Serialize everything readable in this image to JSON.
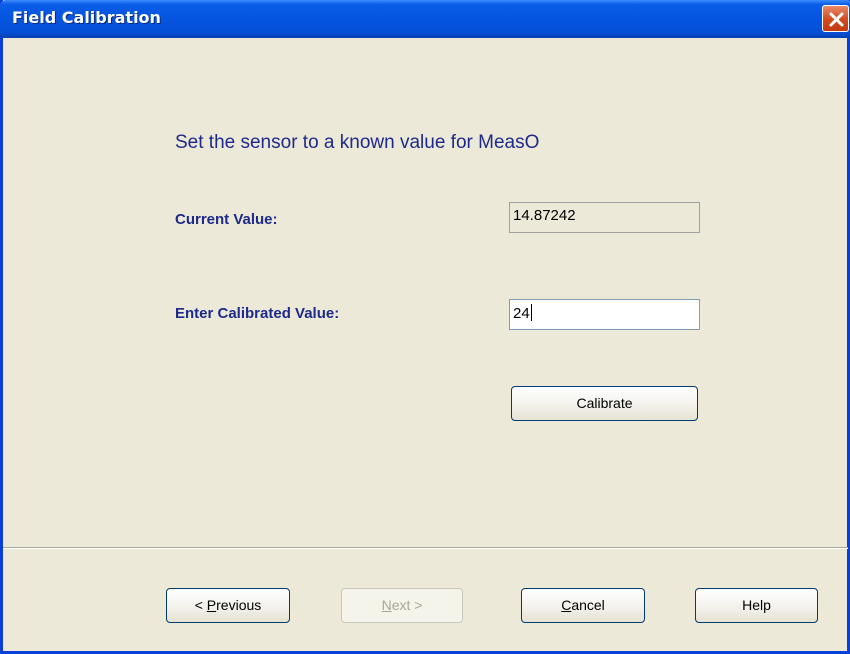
{
  "window": {
    "title": "Field Calibration"
  },
  "main": {
    "heading": "Set the sensor to a known value for MeasO",
    "current_value_label": "Current Value:",
    "current_value": "14.87242",
    "calibrated_value_label": "Enter Calibrated Value:",
    "calibrated_value": "24",
    "calibrate_button": "Calibrate"
  },
  "footer": {
    "previous_mnemonic": "P",
    "previous_rest": "revious",
    "previous_prefix": "< ",
    "next_mnemonic": "N",
    "next_rest": "ext >",
    "cancel_mnemonic": "C",
    "cancel_rest": "ancel",
    "help": "Help"
  },
  "colors": {
    "title_bar": "#0554e0",
    "label_text": "#1e2a8a",
    "dialog_bg": "#ece9d8"
  }
}
